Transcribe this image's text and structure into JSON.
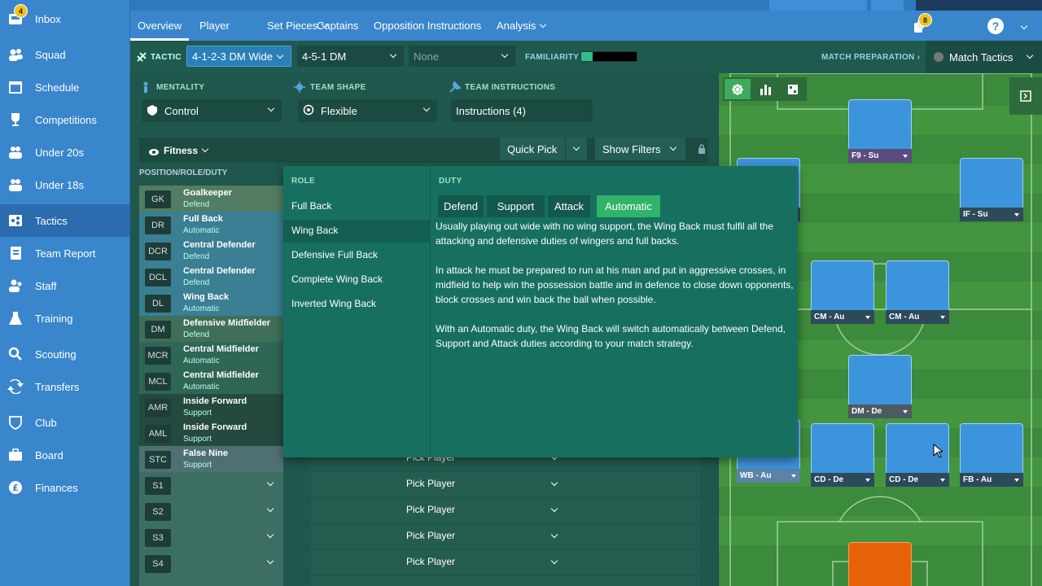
{
  "sidebar": {
    "items": [
      {
        "label": "Inbox",
        "icon": "inbox-icon",
        "badge": "4"
      },
      {
        "label": "Squad",
        "icon": "squad-icon"
      },
      {
        "label": "Schedule",
        "icon": "calendar-icon"
      },
      {
        "label": "Competitions",
        "icon": "trophy-icon"
      },
      {
        "label": "Under 20s",
        "icon": "u20-icon"
      },
      {
        "label": "Under 18s",
        "icon": "u18-icon"
      },
      {
        "label": "Tactics",
        "icon": "tactics-icon"
      },
      {
        "label": "Team Report",
        "icon": "report-icon"
      },
      {
        "label": "Staff",
        "icon": "staff-icon"
      },
      {
        "label": "Training",
        "icon": "training-icon"
      },
      {
        "label": "Scouting",
        "icon": "search-icon"
      },
      {
        "label": "Transfers",
        "icon": "transfers-icon"
      },
      {
        "label": "Club",
        "icon": "shield-icon"
      },
      {
        "label": "Board",
        "icon": "board-icon"
      },
      {
        "label": "Finances",
        "icon": "pound-icon"
      }
    ]
  },
  "topnav": {
    "tabs": [
      "Overview",
      "Player",
      "Set Pieces",
      "Captains",
      "Opposition Instructions",
      "Analysis"
    ],
    "notif_badge": "8",
    "help": "?"
  },
  "tacticbar": {
    "label": "TACTIC",
    "tactic1": "4-1-2-3 DM Wide",
    "tactic2": "4-5-1 DM",
    "tactic3": "None",
    "familiarity_label": "FAMILIARITY",
    "familiarity_level": 0.2,
    "match_prep": "MATCH PREPARATION",
    "match_tactics": "Match Tactics"
  },
  "options": {
    "mentality_label": "MENTALITY",
    "mentality": "Control",
    "shape_label": "TEAM SHAPE",
    "shape": "Flexible",
    "instructions_label": "TEAM INSTRUCTIONS",
    "instructions": "Instructions (4)"
  },
  "filters": {
    "fitness": "Fitness",
    "quick_pick": "Quick Pick",
    "show_filters": "Show Filters",
    "column_header": "POSITION/ROLE/DUTY"
  },
  "positions": [
    {
      "pos": "GK",
      "role": "Goalkeeper",
      "duty": "Defend"
    },
    {
      "pos": "DR",
      "role": "Full Back",
      "duty": "Automatic"
    },
    {
      "pos": "DCR",
      "role": "Central Defender",
      "duty": "Defend"
    },
    {
      "pos": "DCL",
      "role": "Central Defender",
      "duty": "Defend"
    },
    {
      "pos": "DL",
      "role": "Wing Back",
      "duty": "Automatic"
    },
    {
      "pos": "DM",
      "role": "Defensive Midfielder",
      "duty": "Defend"
    },
    {
      "pos": "MCR",
      "role": "Central Midfielder",
      "duty": "Automatic"
    },
    {
      "pos": "MCL",
      "role": "Central Midfielder",
      "duty": "Automatic"
    },
    {
      "pos": "AMR",
      "role": "Inside Forward",
      "duty": "Support"
    },
    {
      "pos": "AML",
      "role": "Inside Forward",
      "duty": "Support"
    },
    {
      "pos": "STC",
      "role": "False Nine",
      "duty": "Support"
    }
  ],
  "subs": [
    "S1",
    "S2",
    "S3",
    "S4"
  ],
  "pick_player": "Pick Player",
  "popup": {
    "role_header": "ROLE",
    "duty_header": "DUTY",
    "roles": [
      "Full Back",
      "Wing Back",
      "Defensive Full Back",
      "Complete Wing Back",
      "Inverted Wing Back"
    ],
    "selected_role": "Wing Back",
    "duties": [
      "Defend",
      "Support",
      "Attack",
      "Automatic"
    ],
    "selected_duty": "Automatic",
    "description": [
      "Usually playing out wide with no wing support, the Wing Back must fulfil all the attacking and defensive duties of wingers and full backs.",
      "In attack he must be prepared to run at his man and put in aggressive crosses, in midfield to help win the possession battle and in defence to close down opponents, block crosses and win back the ball when possible.",
      "With an Automatic duty, the Wing Back will switch automatically between Defend, Support and Attack duties according to your match strategy."
    ]
  },
  "pitch": {
    "cards": [
      "F9 - Su",
      "IF - Su",
      "CM - Au",
      "CM - Au",
      "DM - De",
      "WB - Au",
      "CD - De",
      "CD - De",
      "FB - Au"
    ],
    "colors": {
      "card": "#3c94dc",
      "gk": "#e8620a",
      "pitch": "#3c8a3c"
    }
  }
}
